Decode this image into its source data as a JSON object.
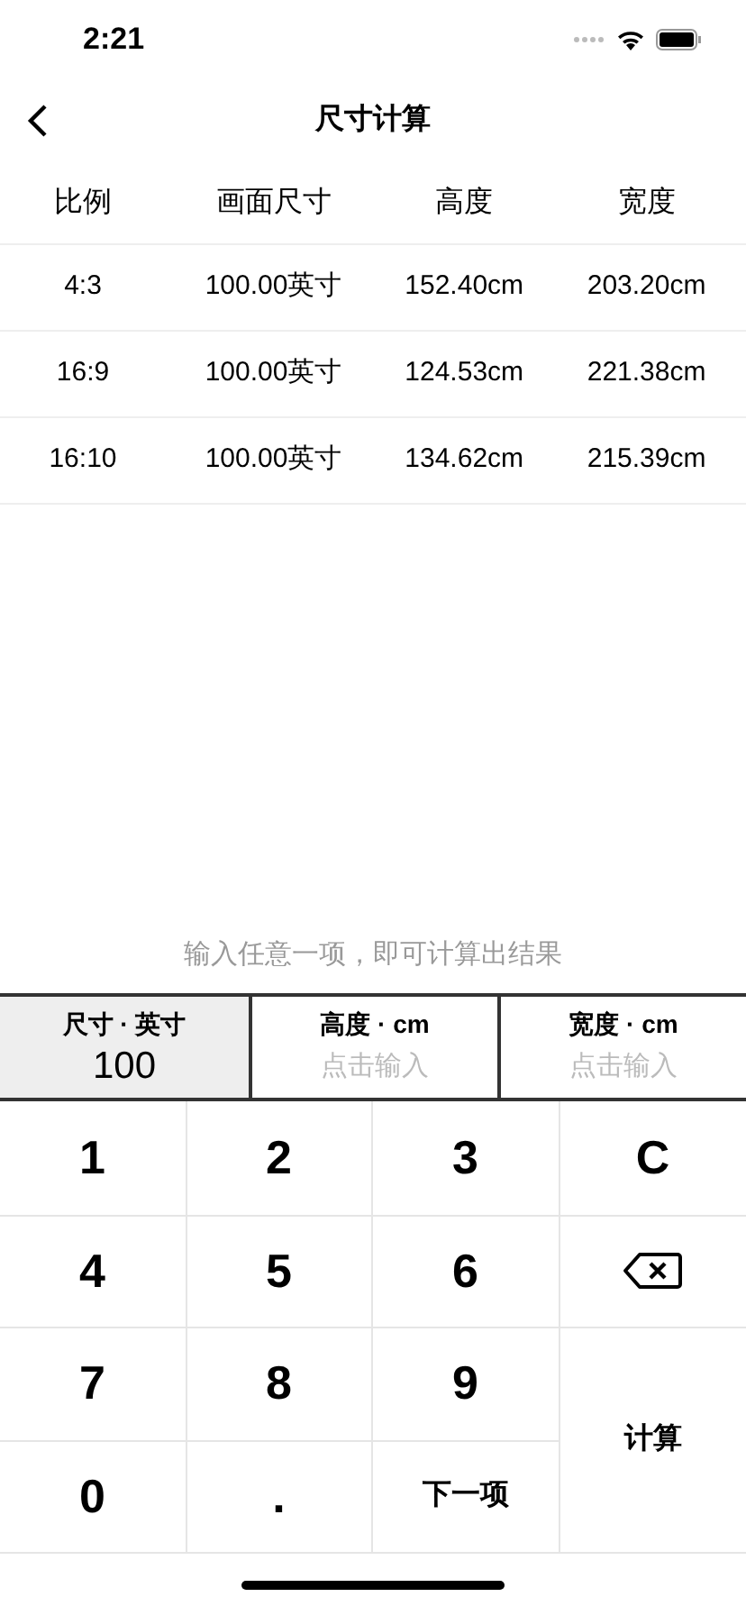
{
  "status_bar": {
    "time": "2:21"
  },
  "nav": {
    "title": "尺寸计算"
  },
  "table": {
    "columns": [
      "比例",
      "画面尺寸",
      "高度",
      "宽度"
    ],
    "rows": [
      [
        "4:3",
        "100.00英寸",
        "152.40cm",
        "203.20cm"
      ],
      [
        "16:9",
        "100.00英寸",
        "124.53cm",
        "221.38cm"
      ],
      [
        "16:10",
        "100.00英寸",
        "134.62cm",
        "215.39cm"
      ]
    ]
  },
  "hint": "输入任意一项，即可计算出结果",
  "inputs": [
    {
      "label": "尺寸 · 英寸",
      "value": "100",
      "selected": true
    },
    {
      "label": "高度 · cm",
      "placeholder": "点击输入",
      "selected": false
    },
    {
      "label": "宽度 · cm",
      "placeholder": "点击输入",
      "selected": false
    }
  ],
  "keypad": [
    {
      "kind": "digit",
      "label": "1"
    },
    {
      "kind": "digit",
      "label": "2"
    },
    {
      "kind": "digit",
      "label": "3"
    },
    {
      "kind": "digit",
      "label": "C"
    },
    {
      "kind": "digit",
      "label": "4"
    },
    {
      "kind": "digit",
      "label": "5"
    },
    {
      "kind": "digit",
      "label": "6"
    },
    {
      "kind": "backspace"
    },
    {
      "kind": "digit",
      "label": "7"
    },
    {
      "kind": "digit",
      "label": "8"
    },
    {
      "kind": "digit",
      "label": "9"
    },
    {
      "kind": "action",
      "label": "计算"
    },
    {
      "kind": "digit",
      "label": "0"
    },
    {
      "kind": "digit",
      "label": "."
    },
    {
      "kind": "action",
      "label": "下一项"
    }
  ]
}
